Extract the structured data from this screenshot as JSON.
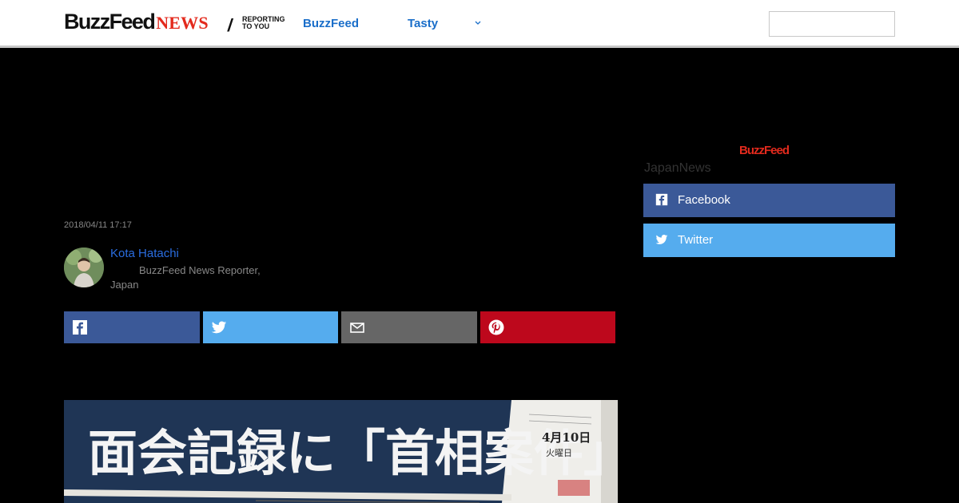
{
  "header": {
    "logo_main": "BuzzFeed",
    "logo_news": "NEWS",
    "logo_tagline_line1": "REPORTING",
    "logo_tagline_line2": "TO YOU",
    "nav": [
      {
        "label": "BuzzFeed"
      },
      {
        "label": "Tasty"
      }
    ],
    "search_placeholder": ""
  },
  "article": {
    "timestamp": "2018/04/11 17:17",
    "author": {
      "name": "Kota Hatachi",
      "role": "BuzzFeed News Reporter, Japan"
    },
    "share_buttons": [
      {
        "network": "facebook",
        "icon": "facebook-icon",
        "color": "#3b5998"
      },
      {
        "network": "twitter",
        "icon": "twitter-icon",
        "color": "#55acee"
      },
      {
        "network": "email",
        "icon": "email-icon",
        "color": "#666666"
      },
      {
        "network": "pinterest",
        "icon": "pinterest-icon",
        "color": "#bd081c"
      }
    ],
    "hero": {
      "headline_text": "面会記録に「首相案件」",
      "date_stamp": "4月10日",
      "weekday_stamp": "火曜日"
    }
  },
  "sidebar": {
    "logo": "BuzzFeed",
    "title": "JapanNews",
    "follow": [
      {
        "label": "Facebook",
        "icon": "facebook-icon",
        "color": "#3b5998"
      },
      {
        "label": "Twitter",
        "icon": "twitter-icon",
        "color": "#55acee"
      }
    ]
  },
  "colors": {
    "brand_red": "#e32a1d",
    "link_blue": "#1a6ec9",
    "background": "#000000"
  }
}
